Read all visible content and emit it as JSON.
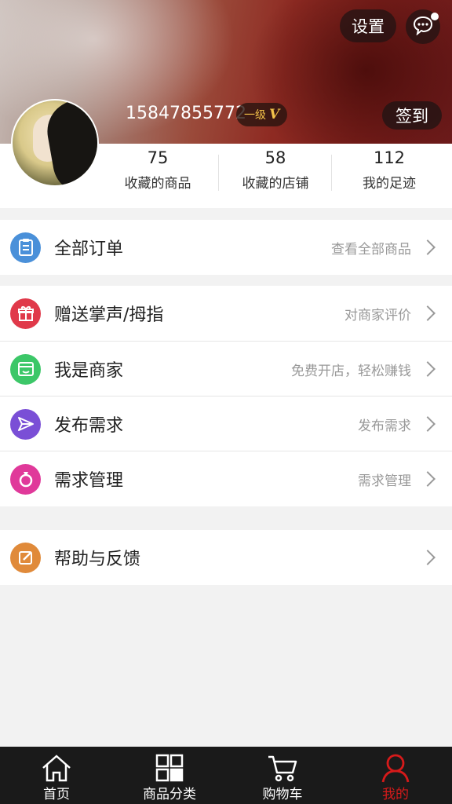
{
  "header": {
    "settings_label": "设置",
    "phone": "15847855772",
    "level_text": "一级",
    "level_mark": "V",
    "signin_label": "签到"
  },
  "stats": [
    {
      "value": "75",
      "label": "收藏的商品"
    },
    {
      "value": "58",
      "label": "收藏的店铺"
    },
    {
      "value": "112",
      "label": "我的足迹"
    }
  ],
  "menu": {
    "orders": {
      "title": "全部订单",
      "sub": "查看全部商品",
      "color": "#4a90d9",
      "icon": "clipboard-icon"
    },
    "gift": {
      "title": "赠送掌声/拇指",
      "sub": "对商家评价",
      "color": "#e0394a",
      "icon": "gift-icon"
    },
    "merchant": {
      "title": "我是商家",
      "sub": "免费开店，轻松赚钱",
      "color": "#3cc768",
      "icon": "store-icon"
    },
    "publish": {
      "title": "发布需求",
      "sub": "发布需求",
      "color": "#7a4fd6",
      "icon": "paper-plane-icon"
    },
    "manage": {
      "title": "需求管理",
      "sub": "需求管理",
      "color": "#e0399a",
      "icon": "ring-icon"
    },
    "help": {
      "title": "帮助与反馈",
      "sub": "",
      "color": "#e08a3a",
      "icon": "edit-icon"
    }
  },
  "tabbar": {
    "items": [
      {
        "label": "首页",
        "icon": "home-icon"
      },
      {
        "label": "商品分类",
        "icon": "grid-icon"
      },
      {
        "label": "购物车",
        "icon": "cart-icon"
      },
      {
        "label": "我的",
        "icon": "user-icon"
      }
    ],
    "active_color": "#d61a1a"
  }
}
